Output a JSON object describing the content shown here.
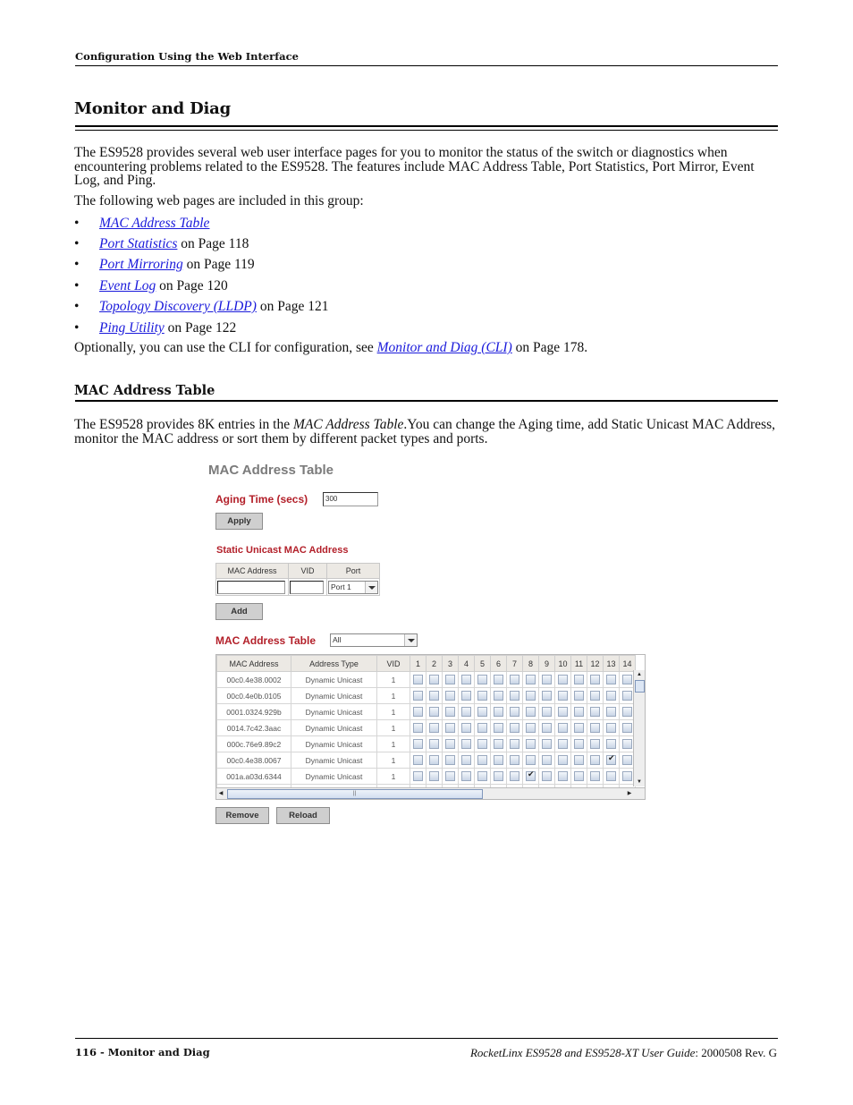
{
  "header": {
    "running_title": "Configuration Using the Web Interface"
  },
  "section": {
    "title": "Monitor and Diag",
    "intro": "The ES9528 provides several web user interface pages for you to monitor the status of the switch or diagnostics when encountering problems related to the ES9528. The features include MAC Address Table, Port Statistics, Port Mirror, Event Log, and Ping.",
    "group_intro": "The following web pages are included in this group:",
    "bullets": [
      {
        "link": "MAC Address Table",
        "suffix": ""
      },
      {
        "link": "Port Statistics",
        "suffix": " on Page 118"
      },
      {
        "link": "Port Mirroring",
        "suffix": " on Page 119"
      },
      {
        "link": "Event Log",
        "suffix": " on Page 120"
      },
      {
        "link": "Topology Discovery (LLDP)",
        "suffix": " on Page 121"
      },
      {
        "link": "Ping Utility",
        "suffix": " on Page 122"
      }
    ],
    "cli_prefix": "Optionally, you can use the CLI for configuration, see ",
    "cli_link": "Monitor and Diag (CLI)",
    "cli_suffix": " on Page 178."
  },
  "subsection": {
    "title": "MAC Address Table",
    "para_prefix": "The ES9528 provides 8K entries in the ",
    "para_italic": "MAC Address Table",
    "para_suffix": ".You can change the Aging time, add Static Unicast MAC Address, monitor the MAC address or sort them by different packet types and ports."
  },
  "ui": {
    "title": "MAC Address Table",
    "aging_label": "Aging Time (secs)",
    "aging_value": "300",
    "apply_label": "Apply",
    "static_label": "Static Unicast MAC Address",
    "static_headers": [
      "MAC Address",
      "VID",
      "Port"
    ],
    "static_mac_value": "",
    "static_vid_value": "",
    "static_port_selected": "Port 1",
    "add_label": "Add",
    "table_label": "MAC Address Table",
    "filter_selected": "All",
    "grid_headers": [
      "MAC Address",
      "Address Type",
      "VID",
      "1",
      "2",
      "3",
      "4",
      "5",
      "6",
      "7",
      "8",
      "9",
      "10",
      "11",
      "12",
      "13",
      "14"
    ],
    "rows": [
      {
        "mac": "00c0.4e38.0002",
        "type": "Dynamic Unicast",
        "vid": "1",
        "checked_ports": []
      },
      {
        "mac": "00c0.4e0b.0105",
        "type": "Dynamic Unicast",
        "vid": "1",
        "checked_ports": []
      },
      {
        "mac": "0001.0324.929b",
        "type": "Dynamic Unicast",
        "vid": "1",
        "checked_ports": []
      },
      {
        "mac": "0014.7c42.3aac",
        "type": "Dynamic Unicast",
        "vid": "1",
        "checked_ports": []
      },
      {
        "mac": "000c.76e9.89c2",
        "type": "Dynamic Unicast",
        "vid": "1",
        "checked_ports": []
      },
      {
        "mac": "00c0.4e38.0067",
        "type": "Dynamic Unicast",
        "vid": "1",
        "checked_ports": [
          13
        ]
      },
      {
        "mac": "001a.a03d.6344",
        "type": "Dynamic Unicast",
        "vid": "1",
        "checked_ports": [
          8
        ]
      }
    ],
    "remove_label": "Remove",
    "reload_label": "Reload"
  },
  "footer": {
    "left": "116 - Monitor and Diag",
    "right_italic": "RocketLinx ES9528 and ES9528-XT User Guide",
    "right_plain": ": 2000508 Rev. G"
  }
}
